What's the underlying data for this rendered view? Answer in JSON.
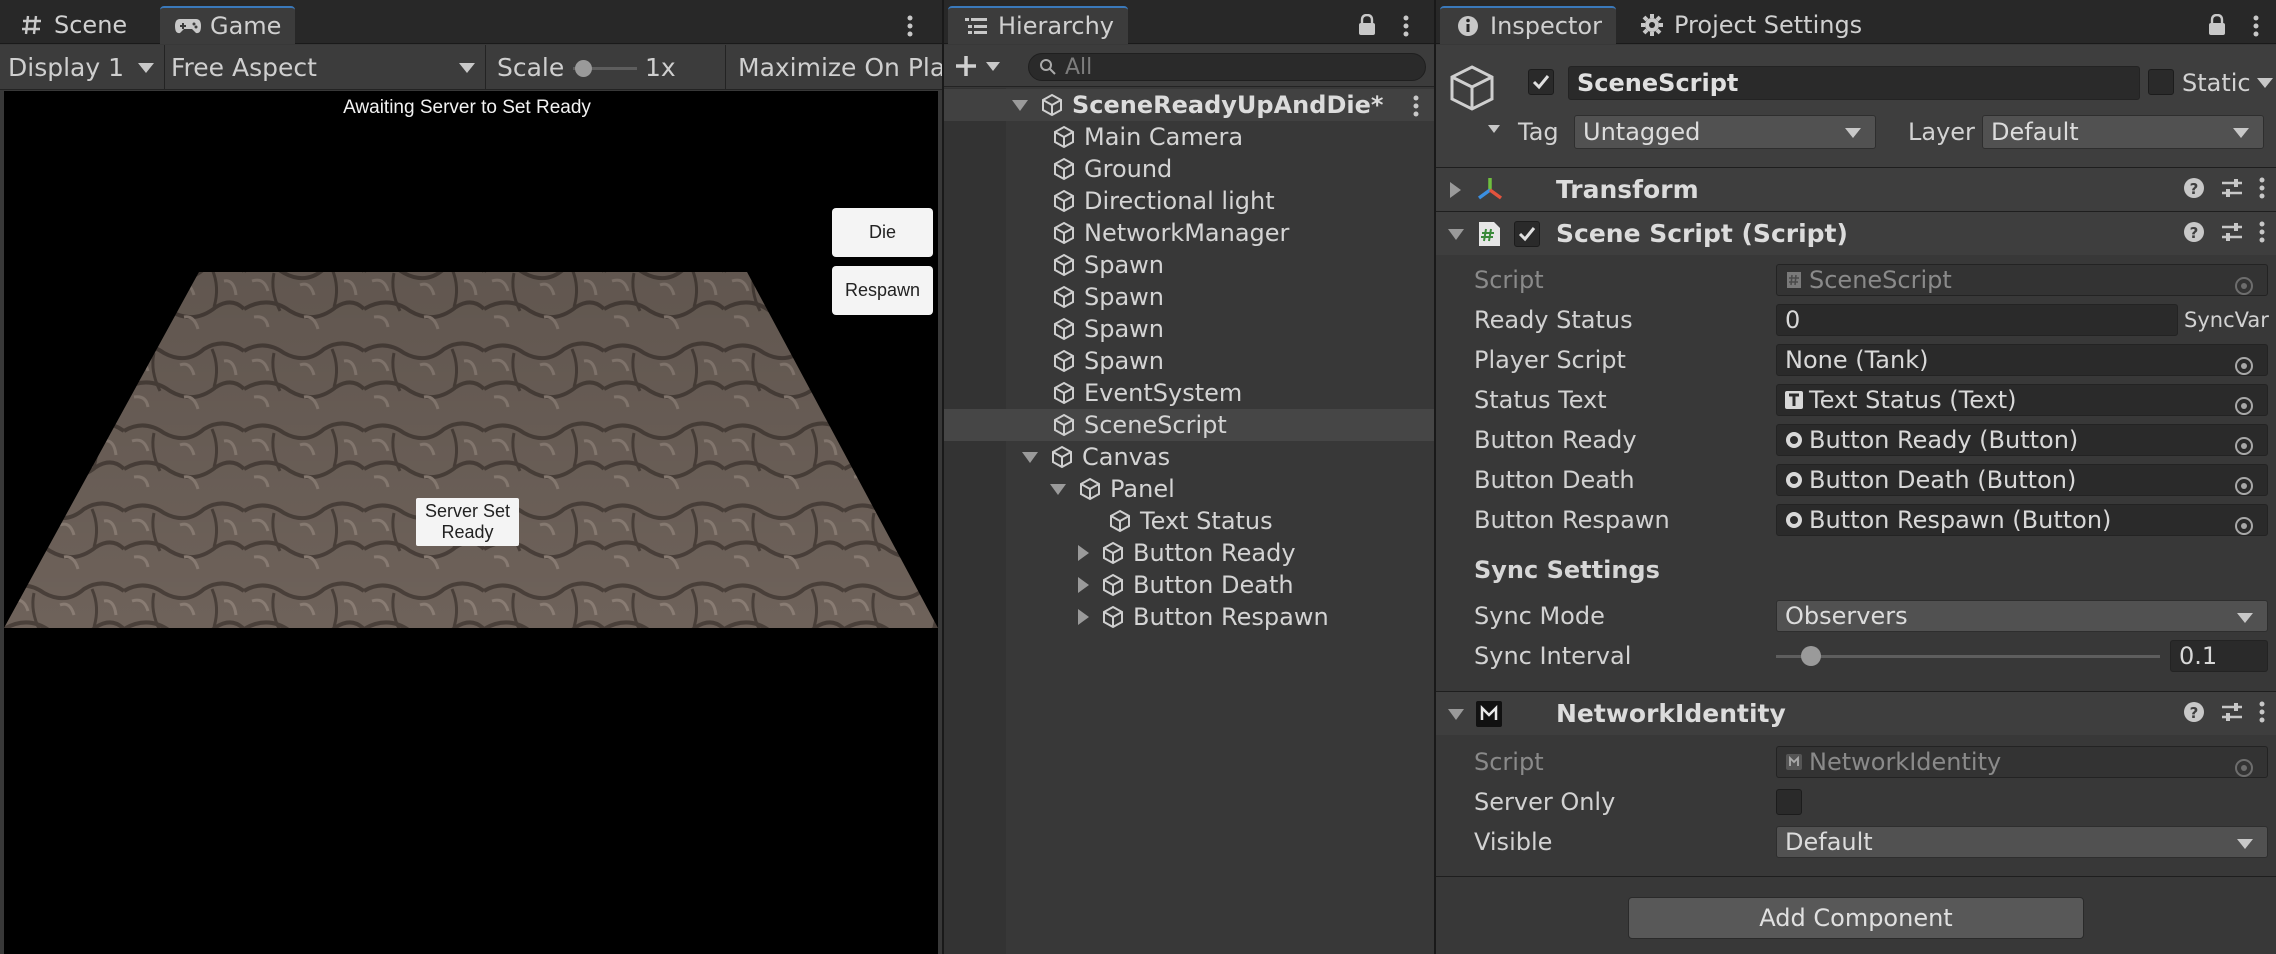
{
  "game_panel": {
    "tabs": [
      {
        "label": "Scene",
        "icon": "grid-hash-icon"
      },
      {
        "label": "Game",
        "icon": "gamepad-icon"
      }
    ],
    "toolbar": {
      "display": "Display 1",
      "aspect": "Free Aspect",
      "scale_label": "Scale",
      "scale_value": "1x",
      "maximize": "Maximize On Play"
    },
    "view": {
      "status_text": "Awaiting Server to Set Ready",
      "die_button": "Die",
      "respawn_button": "Respawn",
      "server_ready_line1": "Server Set",
      "server_ready_line2": "Ready"
    }
  },
  "hierarchy": {
    "tab_label": "Hierarchy",
    "search_placeholder": "All",
    "scene_name": "SceneReadyUpAndDie*",
    "items": [
      {
        "label": "Main Camera"
      },
      {
        "label": "Ground"
      },
      {
        "label": "Directional light"
      },
      {
        "label": "NetworkManager"
      },
      {
        "label": "Spawn"
      },
      {
        "label": "Spawn"
      },
      {
        "label": "Spawn"
      },
      {
        "label": "Spawn"
      },
      {
        "label": "EventSystem"
      },
      {
        "label": "SceneScript",
        "selected": true
      },
      {
        "label": "Canvas",
        "expanded": true
      },
      {
        "label": "Panel",
        "expanded": true
      },
      {
        "label": "Text Status"
      },
      {
        "label": "Button Ready",
        "collapsed": true
      },
      {
        "label": "Button Death",
        "collapsed": true
      },
      {
        "label": "Button Respawn",
        "collapsed": true
      }
    ]
  },
  "inspector": {
    "tabs": [
      {
        "label": "Inspector",
        "icon": "info-icon"
      },
      {
        "label": "Project Settings",
        "icon": "gear-icon"
      }
    ],
    "object_name": "SceneScript",
    "static_label": "Static",
    "tag_label": "Tag",
    "tag_value": "Untagged",
    "layer_label": "Layer",
    "layer_value": "Default",
    "transform_title": "Transform",
    "scene_script": {
      "title": "Scene Script (Script)",
      "script_label": "Script",
      "script_value": "SceneScript",
      "ready_status_label": "Ready Status",
      "ready_status_value": "0",
      "syncvar_label": "SyncVar",
      "player_script_label": "Player Script",
      "player_script_value": "None (Tank)",
      "status_text_label": "Status Text",
      "status_text_value": "Text Status (Text)",
      "button_ready_label": "Button Ready",
      "button_ready_value": "Button Ready (Button)",
      "button_death_label": "Button Death",
      "button_death_value": "Button Death (Button)",
      "button_respawn_label": "Button Respawn",
      "button_respawn_value": "Button Respawn (Button)",
      "sync_settings_heading": "Sync Settings",
      "sync_mode_label": "Sync Mode",
      "sync_mode_value": "Observers",
      "sync_interval_label": "Sync Interval",
      "sync_interval_value": "0.1",
      "sync_interval_slider_fraction": 0.07
    },
    "network_identity": {
      "title": "NetworkIdentity",
      "script_label": "Script",
      "script_value": "NetworkIdentity",
      "server_only_label": "Server Only",
      "visible_label": "Visible",
      "visible_value": "Default"
    },
    "add_component": "Add Component"
  },
  "colors": {
    "accent": "#3a79bb",
    "panel_bg": "#383838",
    "tab_bar": "#282828",
    "selection": "#464646"
  }
}
